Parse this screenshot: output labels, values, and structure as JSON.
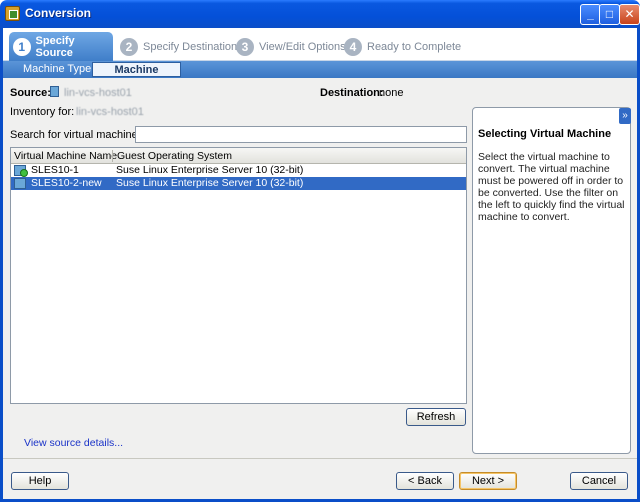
{
  "window": {
    "title": "Conversion"
  },
  "steps": [
    {
      "num": "1",
      "label": "Specify Source"
    },
    {
      "num": "2",
      "label": "Specify Destination"
    },
    {
      "num": "3",
      "label": "View/Edit Options"
    },
    {
      "num": "4",
      "label": "Ready to Complete"
    }
  ],
  "subtabs": [
    "Machine Type",
    "Machine Name"
  ],
  "source": {
    "label": "Source:",
    "value": "lin-vcs-host01"
  },
  "destination": {
    "label": "Destination:",
    "value": "none"
  },
  "inventory": {
    "label": "Inventory for:",
    "value": "lin-vcs-host01"
  },
  "search": {
    "label": "Search for virtual machine with:",
    "placeholder": ""
  },
  "table": {
    "columns": [
      "Virtual Machine Name",
      "Guest Operating System"
    ],
    "rows": [
      {
        "name": "SLES10-1",
        "os": "Suse Linux Enterprise Server 10 (32-bit)"
      },
      {
        "name": "SLES10-2-new",
        "os": "Suse Linux Enterprise Server 10 (32-bit)"
      }
    ]
  },
  "buttons": {
    "refresh": "Refresh",
    "help": "Help",
    "back": "< Back",
    "next": "Next >",
    "cancel": "Cancel"
  },
  "link": "View source details...",
  "help_panel": {
    "title": "Selecting Virtual Machine",
    "body": "Select the virtual machine to convert. The virtual machine must be powered off in order to be converted. Use the filter on the left to quickly find the virtual machine to convert."
  }
}
